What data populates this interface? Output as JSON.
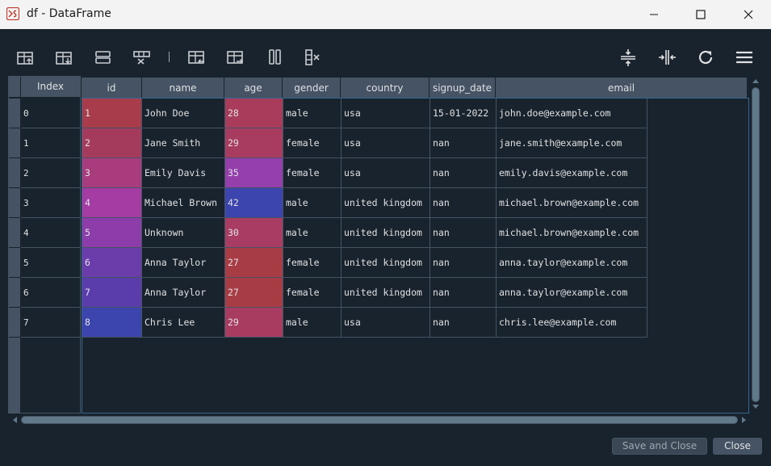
{
  "window": {
    "title": "df - DataFrame"
  },
  "toolbar": {
    "left_tools": [
      {
        "name": "insert-row-above-icon"
      },
      {
        "name": "insert-row-below-icon"
      },
      {
        "name": "rows-icon"
      },
      {
        "name": "delete-row-icon"
      },
      {
        "name": "insert-column-left-icon"
      },
      {
        "name": "insert-column-right-icon"
      },
      {
        "name": "columns-icon"
      },
      {
        "name": "delete-column-icon"
      }
    ],
    "right_tools": [
      {
        "name": "resize-rows-icon"
      },
      {
        "name": "resize-columns-icon"
      },
      {
        "name": "refresh-icon"
      },
      {
        "name": "menu-icon"
      }
    ]
  },
  "table": {
    "index_header": "Index",
    "columns": [
      "id",
      "name",
      "age",
      "gender",
      "country",
      "signup_date",
      "email"
    ],
    "index": [
      "0",
      "1",
      "2",
      "3",
      "4",
      "5",
      "6",
      "7"
    ],
    "rows": [
      [
        "1",
        "John Doe",
        "28",
        "male",
        "usa",
        "15-01-2022",
        "john.doe@example.com"
      ],
      [
        "2",
        "Jane Smith",
        "29",
        "female",
        "usa",
        "nan",
        "jane.smith@example.com"
      ],
      [
        "3",
        "Emily Davis",
        "35",
        "female",
        "usa",
        "nan",
        "emily.davis@example.com"
      ],
      [
        "4",
        "Michael Brown",
        "42",
        "male",
        "united kingdom",
        "nan",
        "michael.brown@example.com"
      ],
      [
        "5",
        "Unknown",
        "30",
        "male",
        "united kingdom",
        "nan",
        "michael.brown@example.com"
      ],
      [
        "6",
        "Anna Taylor",
        "27",
        "female",
        "united kingdom",
        "nan",
        "anna.taylor@example.com"
      ],
      [
        "7",
        "Anna Taylor",
        "27",
        "female",
        "united kingdom",
        "nan",
        "anna.taylor@example.com"
      ],
      [
        "8",
        "Chris Lee",
        "29",
        "male",
        "usa",
        "nan",
        "chris.lee@example.com"
      ]
    ],
    "colors": {
      "id": [
        "#a83c4a",
        "#a53b5c",
        "#a83c7c",
        "#a43ca3",
        "#8c3daa",
        "#6a3dab",
        "#5a3dab",
        "#3c44ad"
      ],
      "age": [
        "#a83c5a",
        "#a83c60",
        "#943fac",
        "#3c44ad",
        "#a83c62",
        "#a83c45",
        "#a83c45",
        "#a83c60"
      ]
    }
  },
  "footer": {
    "save_label": "Save and Close",
    "close_label": "Close"
  },
  "theme": {
    "background": "#19232d",
    "header": "#455364",
    "border": "#455364",
    "selection_border": "#346792",
    "text": "#e0e1e3"
  }
}
